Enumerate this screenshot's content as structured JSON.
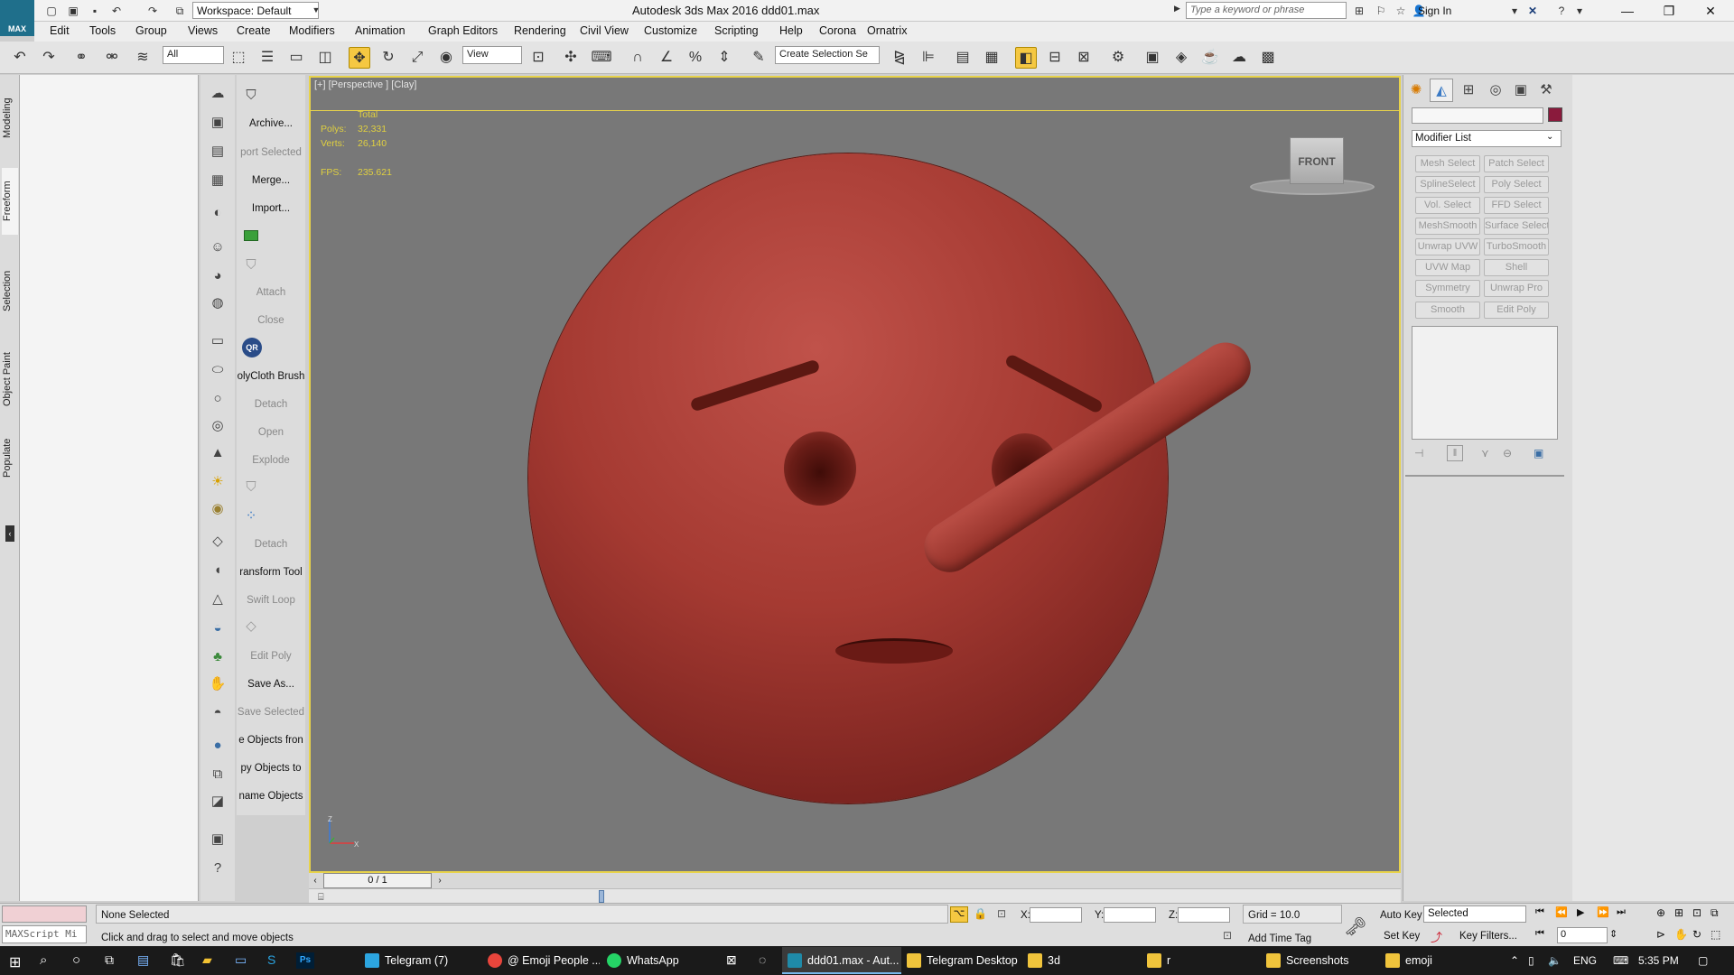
{
  "app": {
    "logo": "MAX",
    "title": "Autodesk 3ds Max 2016      ddd01.max",
    "workspace": "Workspace: Default",
    "search_placeholder": "Type a keyword or phrase",
    "sign_in": "Sign In"
  },
  "menu": [
    "Edit",
    "Tools",
    "Group",
    "Views",
    "Create",
    "Modifiers",
    "Animation",
    "Graph Editors",
    "Rendering",
    "Civil View",
    "Customize",
    "Scripting",
    "Help",
    "Corona",
    "Ornatrix"
  ],
  "toolbar": {
    "filter": "All",
    "ref_coord": "View",
    "named_selection": "Create Selection Se"
  },
  "left_tabs": [
    "Modeling",
    "Freeform",
    "Selection",
    "Object Paint",
    "Populate"
  ],
  "command_items": [
    {
      "label": "Archive...",
      "disabled": false
    },
    {
      "label": "port Selected",
      "disabled": true
    },
    {
      "label": "Merge...",
      "disabled": false
    },
    {
      "label": "Import...",
      "disabled": false
    },
    {
      "label": "Attach",
      "disabled": true
    },
    {
      "label": "Close",
      "disabled": true
    },
    {
      "label": "olyCloth Brush",
      "disabled": false
    },
    {
      "label": "Detach",
      "disabled": true
    },
    {
      "label": "Open",
      "disabled": true
    },
    {
      "label": "Explode",
      "disabled": true
    },
    {
      "label": "Detach",
      "disabled": true
    },
    {
      "label": "ransform Tool",
      "disabled": false
    },
    {
      "label": "Swift Loop",
      "disabled": true
    },
    {
      "label": "Edit Poly",
      "disabled": true
    },
    {
      "label": "Save As...",
      "disabled": false
    },
    {
      "label": "Save Selected",
      "disabled": true
    },
    {
      "label": "e Objects fron",
      "disabled": false
    },
    {
      "label": "py Objects to",
      "disabled": false
    },
    {
      "label": "name Objects",
      "disabled": false
    }
  ],
  "viewport": {
    "label": "[+] [Perspective ] [Clay]",
    "stats_header": "Total",
    "polys_label": "Polys:",
    "polys_value": "32,331",
    "verts_label": "Verts:",
    "verts_value": "26,140",
    "fps_label": "FPS:",
    "fps_value": "235.621",
    "viewcube_label": "FRONT",
    "axis_z": "Z",
    "axis_x": "X"
  },
  "time_slider": "0 / 1",
  "command_panel": {
    "modifier_list": "Modifier List",
    "modifier_buttons": [
      "Mesh Select",
      "Patch Select",
      "SplineSelect",
      "Poly Select",
      "Vol. Select",
      "FFD Select",
      "MeshSmooth",
      "Surface Select",
      "Unwrap UVW",
      "TurboSmooth",
      "UVW Map",
      "Shell",
      "Symmetry",
      "Unwrap Pro",
      "Smooth",
      "Edit Poly"
    ],
    "swatch_color": "#8a1a3c"
  },
  "status": {
    "maxscript": "MAXScript Mi",
    "selection": "None Selected",
    "prompt": "Click and drag to select and move objects",
    "x_label": "X:",
    "y_label": "Y:",
    "z_label": "Z:",
    "grid": "Grid = 10.0",
    "add_time_tag": "Add Time Tag",
    "auto_key": "Auto Key",
    "set_key": "Set Key",
    "selected": "Selected",
    "key_filters": "Key Filters...",
    "frame": "0"
  },
  "taskbar": {
    "items": [
      {
        "label": "Telegram (7)",
        "color": "#2ca5e0",
        "active": false
      },
      {
        "label": "@ Emoji People ...",
        "color": "#e8453c",
        "active": false
      },
      {
        "label": "WhatsApp",
        "color": "#25d366",
        "active": false
      },
      {
        "label": "ddd01.max - Aut...",
        "color": "#1f8aa8",
        "active": true
      },
      {
        "label": "Telegram Desktop",
        "color": "#f0c43c",
        "active": false
      },
      {
        "label": "3d",
        "color": "#f0c43c",
        "active": false
      },
      {
        "label": "r",
        "color": "#f0c43c",
        "active": false
      },
      {
        "label": "Screenshots",
        "color": "#f0c43c",
        "active": false
      },
      {
        "label": "emoji",
        "color": "#f0c43c",
        "active": false
      }
    ],
    "lang": "ENG",
    "time": "5:35 PM"
  }
}
